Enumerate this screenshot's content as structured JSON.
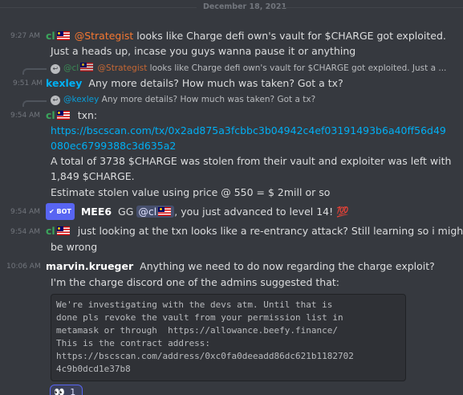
{
  "date_divider": "December 18, 2021",
  "messages": {
    "m1": {
      "time": "9:27 AM",
      "author": "cl",
      "mention": "@Strategist",
      "line1": " looks like Charge defi own's vault for $CHARGE got exploited.",
      "line2": "Just a heads up, incase you guys wanna pause it or anything"
    },
    "m2": {
      "reply_author": "@cl",
      "reply_mention": "@Strategist",
      "reply_text": " looks like Charge defi own's vault for $CHARGE got exploited. Just a ...",
      "time": "9:51 AM",
      "author": "kexley",
      "text": "Any more details? How much was taken? Got a tx?"
    },
    "m3": {
      "reply_author": "@kexley",
      "reply_text": "Any more details? How much was taken? Got a tx?",
      "time": "9:54 AM",
      "author": "cl",
      "line1": "txn:",
      "link1": "https://bscscan.com/tx/0x2ad875a3fcbbc3b04942c4ef03191493b6a40ff56d49",
      "link2": "080ec6799388c3d635a2",
      "line2": "A total of 3738 $CHARGE was stolen from their vault and exploiter was left with",
      "line3": "1,849 $CHARGE.",
      "line4": "Estimate stolen value using price @ 550 = $ 2mill or so"
    },
    "m4": {
      "time": "9:54 AM",
      "badge": "BOT",
      "author": "MEE6",
      "pre": "GG",
      "mention": "@cl",
      "post": ", you just advanced to level 14! ",
      "emoji": "💯"
    },
    "m5": {
      "time": "9:54 AM",
      "author": "cl",
      "line1": "just looking at the txn looks like a re-entrancy attack? Still learning so i might",
      "line2": "be wrong"
    },
    "m6": {
      "time": "10:06 AM",
      "author": "marvin.krueger",
      "line1": "Anything we need to do now regarding the charge exploit?",
      "line2": "I'm the charge discord one of the admins suggested that:",
      "code": "We're investigating with the devs atm. Until that is\ndone pls revoke the vault from your permission list in\nmetamask or through  https://allowance.beefy.finance/\nThis is the contract address:\nhttps://bscscan.com/address/0xc0fa0deeadd86dc621b1182702\n4c9b0dcd1e37b8",
      "reaction_emoji": "👀",
      "reaction_count": "1"
    }
  },
  "colors": {
    "bg": "#36393f",
    "cl": "#3ba55c",
    "kexley": "#00b0f4",
    "strategist": "#f57731",
    "link": "#00aff4"
  }
}
